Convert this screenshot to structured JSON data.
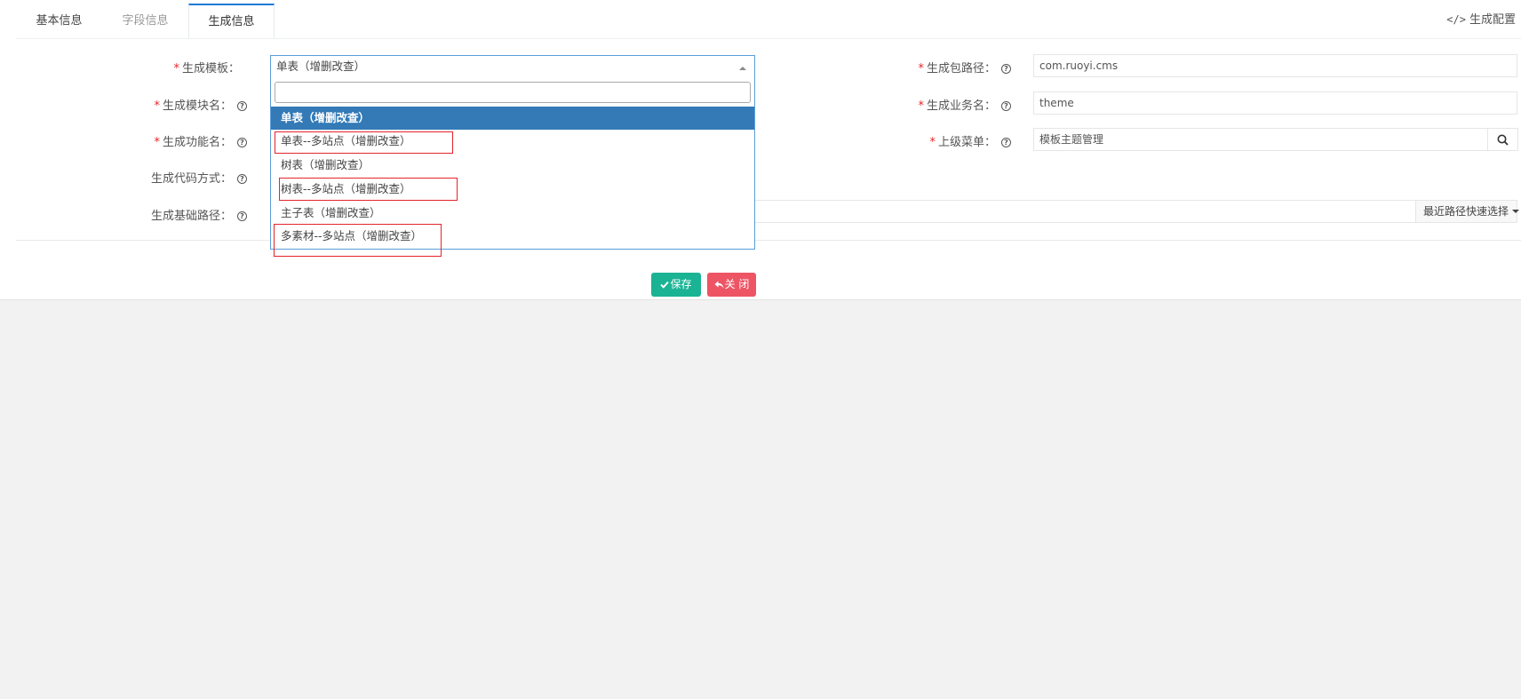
{
  "tabs": [
    {
      "label": "基本信息"
    },
    {
      "label": "字段信息"
    },
    {
      "label": "生成信息"
    }
  ],
  "header": {
    "gen_config": "生成配置",
    "code_icon": "</>"
  },
  "form": {
    "template": {
      "label": "生成模板：",
      "value": "单表（增删改查）"
    },
    "module_name": {
      "label": "生成模块名："
    },
    "function_name": {
      "label": "生成功能名："
    },
    "gen_type": {
      "label": "生成代码方式："
    },
    "base_path": {
      "label": "生成基础路径：",
      "dropdown_label": "最近路径快速选择"
    },
    "package_path": {
      "label": "生成包路径：",
      "value": "com.ruoyi.cms"
    },
    "business_name": {
      "label": "生成业务名：",
      "value": "theme"
    },
    "parent_menu": {
      "label": "上级菜单：",
      "value": "模板主题管理"
    }
  },
  "dropdown": {
    "search_value": "",
    "options": [
      {
        "label": "单表（增删改查）",
        "selected": true
      },
      {
        "label": "单表--多站点（增删改查）",
        "highlighted": true
      },
      {
        "label": "树表（增删改查）"
      },
      {
        "label": "树表--多站点（增删改查）",
        "highlighted": true
      },
      {
        "label": "主子表（增删改查）"
      },
      {
        "label": "多素材--多站点（增删改查）",
        "highlighted": true
      }
    ]
  },
  "buttons": {
    "save": "保存",
    "close": "关 闭"
  },
  "colors": {
    "primary": "#337ab7",
    "save": "#1ab394",
    "close": "#ed5565",
    "highlight_box": "#e4242b"
  }
}
